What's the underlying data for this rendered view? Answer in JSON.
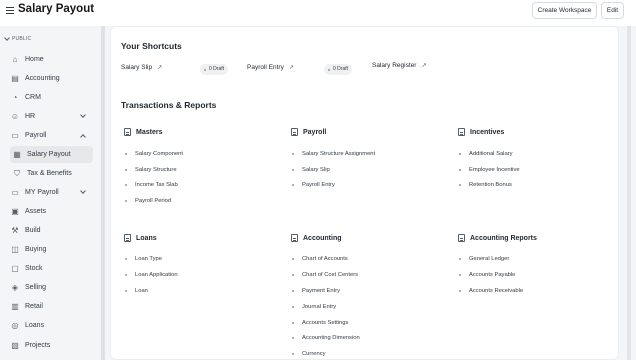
{
  "header": {
    "title": "Salary Payout",
    "create_workspace_label": "Create Workspace",
    "edit_label": "Edit"
  },
  "sidebar": {
    "section": "PUBLIC",
    "items": [
      {
        "label": "Home",
        "icon": "home-icon"
      },
      {
        "label": "Accounting",
        "icon": "accounting-icon"
      },
      {
        "label": "CRM",
        "icon": "crm-icon"
      },
      {
        "label": "HR",
        "icon": "hr-icon"
      },
      {
        "label": "Payroll",
        "icon": "payroll-icon"
      },
      {
        "label": "Salary Payout",
        "icon": "salary-payout-icon"
      },
      {
        "label": "Tax & Benefits",
        "icon": "tax-benefits-icon"
      },
      {
        "label": "MY Payroll",
        "icon": "my-payroll-icon"
      },
      {
        "label": "Assets",
        "icon": "assets-icon"
      },
      {
        "label": "Build",
        "icon": "build-icon"
      },
      {
        "label": "Buying",
        "icon": "buying-icon"
      },
      {
        "label": "Stock",
        "icon": "stock-icon"
      },
      {
        "label": "Selling",
        "icon": "selling-icon"
      },
      {
        "label": "Retail",
        "icon": "retail-icon"
      },
      {
        "label": "Loans",
        "icon": "loans-icon"
      },
      {
        "label": "Projects",
        "icon": "projects-icon"
      }
    ]
  },
  "shortcuts": {
    "heading": "Your Shortcuts",
    "items": [
      {
        "label": "Salary Slip",
        "badge": "0 Draft"
      },
      {
        "label": "Payroll Entry",
        "badge": "0 Draft"
      },
      {
        "label": "Salary Register"
      }
    ]
  },
  "reports": {
    "heading": "Transactions & Reports",
    "cards": [
      {
        "title": "Masters",
        "links": [
          "Salary Component",
          "Salary Structure",
          "Income Tax Slab",
          "Payroll Period"
        ]
      },
      {
        "title": "Payroll",
        "links": [
          "Salary Structure Assignment",
          "Salary Slip",
          "Payroll Entry"
        ]
      },
      {
        "title": "Incentives",
        "links": [
          "Additional Salary",
          "Employee Incentive",
          "Retention Bonus"
        ]
      },
      {
        "title": "Loans",
        "links": [
          "Loan Type",
          "Loan Application",
          "Loan"
        ]
      },
      {
        "title": "Accounting",
        "links": [
          "Chart of Accounts",
          "Chart of Cost Centers",
          "Payment Entry",
          "Journal Entry",
          "Accounts Settings",
          "Accounting Dimension",
          "Currency"
        ]
      },
      {
        "title": "Accounting Reports",
        "links": [
          "General Ledger",
          "Accounts Payable",
          "Accounts Receivable"
        ]
      }
    ]
  }
}
